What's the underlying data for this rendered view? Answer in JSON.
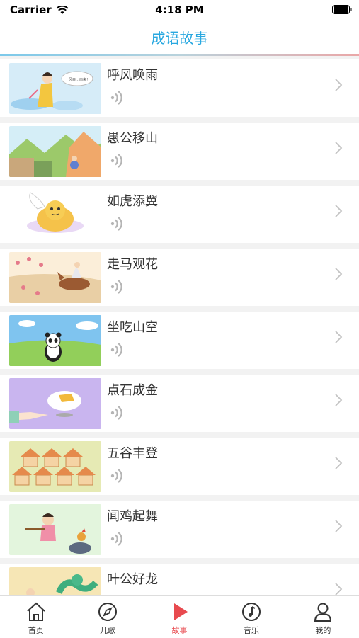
{
  "status_bar": {
    "carrier": "Carrier",
    "time": "4:18 PM"
  },
  "nav": {
    "title": "成语故事"
  },
  "stories": [
    {
      "title": "呼风唤雨",
      "thumb": "cloud-girl"
    },
    {
      "title": "愚公移山",
      "thumb": "mountains"
    },
    {
      "title": "如虎添翼",
      "thumb": "winged-tiger"
    },
    {
      "title": "走马观花",
      "thumb": "horse-rider"
    },
    {
      "title": "坐吃山空",
      "thumb": "panda"
    },
    {
      "title": "点石成金",
      "thumb": "gold-bar"
    },
    {
      "title": "五谷丰登",
      "thumb": "granaries"
    },
    {
      "title": "闻鸡起舞",
      "thumb": "rooster-girl"
    },
    {
      "title": "叶公好龙",
      "thumb": "dragon"
    }
  ],
  "tabbar": {
    "items": [
      {
        "label": "首页",
        "icon": "home-icon",
        "active": false
      },
      {
        "label": "儿歌",
        "icon": "compass-icon",
        "active": false
      },
      {
        "label": "故事",
        "icon": "play-icon",
        "active": true
      },
      {
        "label": "音乐",
        "icon": "music-note-icon",
        "active": false
      },
      {
        "label": "我的",
        "icon": "person-icon",
        "active": false
      }
    ]
  },
  "colors": {
    "accent_blue": "#29a8e0",
    "active_red": "#e84a4f"
  }
}
